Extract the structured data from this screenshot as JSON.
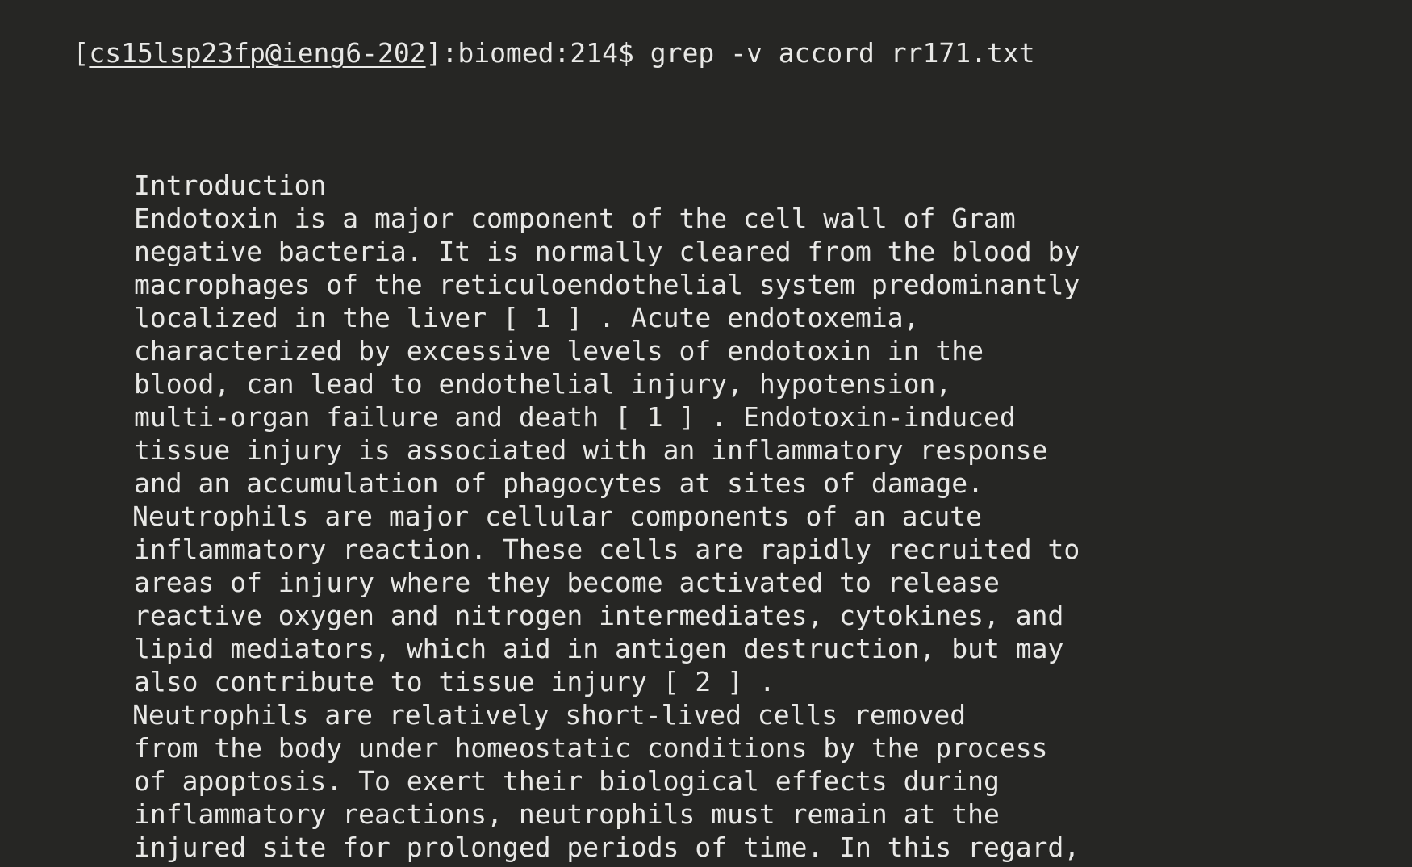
{
  "terminal": {
    "prompt": {
      "open_bracket": "[",
      "user_host": "cs15lsp23fp@ieng6-202",
      "rest": "]:biomed:214$ ",
      "command": "grep -v accord rr171.txt"
    },
    "lines": [
      "Introduction",
      "Endotoxin is a major component of the cell wall of Gram",
      "negative bacteria. It is normally cleared from the blood by",
      "macrophages of the reticuloendothelial system predominantly",
      "localized in the liver [ 1 ] . Acute endotoxemia,",
      "characterized by excessive levels of endotoxin in the",
      "blood, can lead to endothelial injury, hypotension,",
      "multi-organ failure and death [ 1 ] . Endotoxin-induced",
      "tissue injury is associated with an inflammatory response",
      "and an accumulation of phagocytes at sites of damage.",
      "Neutrophils are major cellular components of an acute",
      "inflammatory reaction. These cells are rapidly recruited to",
      "areas of injury where they become activated to release",
      "reactive oxygen and nitrogen intermediates, cytokines, and",
      "lipid mediators, which aid in antigen destruction, but may",
      "also contribute to tissue injury [ 2 ] .",
      "Neutrophils are relatively short-lived cells removed",
      "from the body under homeostatic conditions by the process",
      "of apoptosis. To exert their biological effects during",
      "inflammatory reactions, neutrophils must remain at the",
      "injured site for prolonged periods of time. In this regard,"
    ]
  }
}
